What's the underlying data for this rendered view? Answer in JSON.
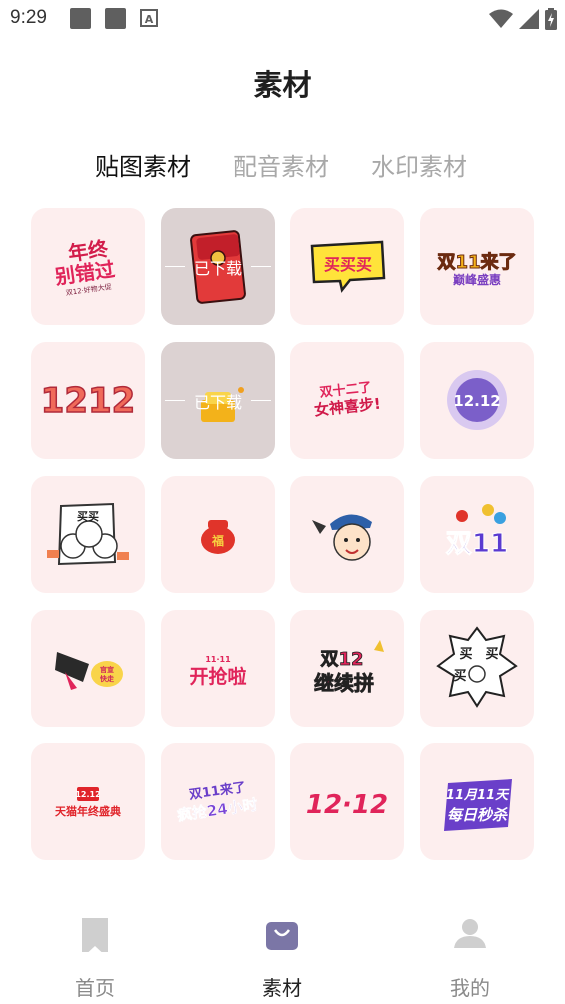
{
  "status_bar": {
    "time": "9:29",
    "notification_a": "A"
  },
  "header": {
    "title": "素材"
  },
  "tabs": [
    {
      "label": "贴图素材",
      "active": true
    },
    {
      "label": "配音素材",
      "active": false
    },
    {
      "label": "水印素材",
      "active": false
    }
  ],
  "downloaded_label": "已下载",
  "stickers": [
    {
      "name": "年终别错过",
      "text": "年终",
      "text2": "别错过",
      "small": "双12·好物大促",
      "downloaded": false
    },
    {
      "name": "红包",
      "text": "",
      "downloaded": true
    },
    {
      "name": "买买买",
      "text": "买买买",
      "downloaded": false
    },
    {
      "name": "双11来了",
      "text": "双11来了",
      "text2": "巅峰盛惠",
      "downloaded": false
    },
    {
      "name": "1212",
      "text": "1212",
      "downloaded": false
    },
    {
      "name": "金币",
      "text": "",
      "downloaded": true
    },
    {
      "name": "双十二女神喜步",
      "text": "双十二了",
      "text2": "女神喜步!",
      "downloaded": false
    },
    {
      "name": "12.12徽章",
      "text": "12.12",
      "downloaded": false
    },
    {
      "name": "买买人群",
      "text": "买买",
      "downloaded": false
    },
    {
      "name": "福袋",
      "text": "福",
      "downloaded": false
    },
    {
      "name": "男孩",
      "text": "",
      "downloaded": false
    },
    {
      "name": "双11气球",
      "text": "双11",
      "downloaded": false
    },
    {
      "name": "喇叭",
      "text": "官宣",
      "text2": "快走",
      "downloaded": false
    },
    {
      "name": "开抢啦",
      "text": "开抢啦",
      "small": "11·11",
      "downloaded": false
    },
    {
      "name": "双12继续拼",
      "text": "双12",
      "text2": "继续拼",
      "downloaded": false
    },
    {
      "name": "买买买气泡",
      "text": "买",
      "downloaded": false
    },
    {
      "name": "天猫年终盛典",
      "text": "天猫年终盛典",
      "small": "12.12",
      "downloaded": false
    },
    {
      "name": "疯抢24小时",
      "text": "双11来了",
      "text2": "疯抢24小时",
      "downloaded": false
    },
    {
      "name": "12.12粉色",
      "text": "12·12",
      "downloaded": false
    },
    {
      "name": "每日秒杀",
      "text": "11月11天",
      "text2": "每日秒杀",
      "downloaded": false
    }
  ],
  "bottom_nav": [
    {
      "label": "首页",
      "icon": "bookmark-icon",
      "active": false
    },
    {
      "label": "素材",
      "icon": "bag-icon",
      "active": true
    },
    {
      "label": "我的",
      "icon": "user-icon",
      "active": false
    }
  ],
  "colors": {
    "accent": "#7b76a6",
    "tile_bg": "#fdeeee",
    "downloaded_tile_bg": "#dcd2d2",
    "inactive_tab": "#a8a8a8"
  }
}
